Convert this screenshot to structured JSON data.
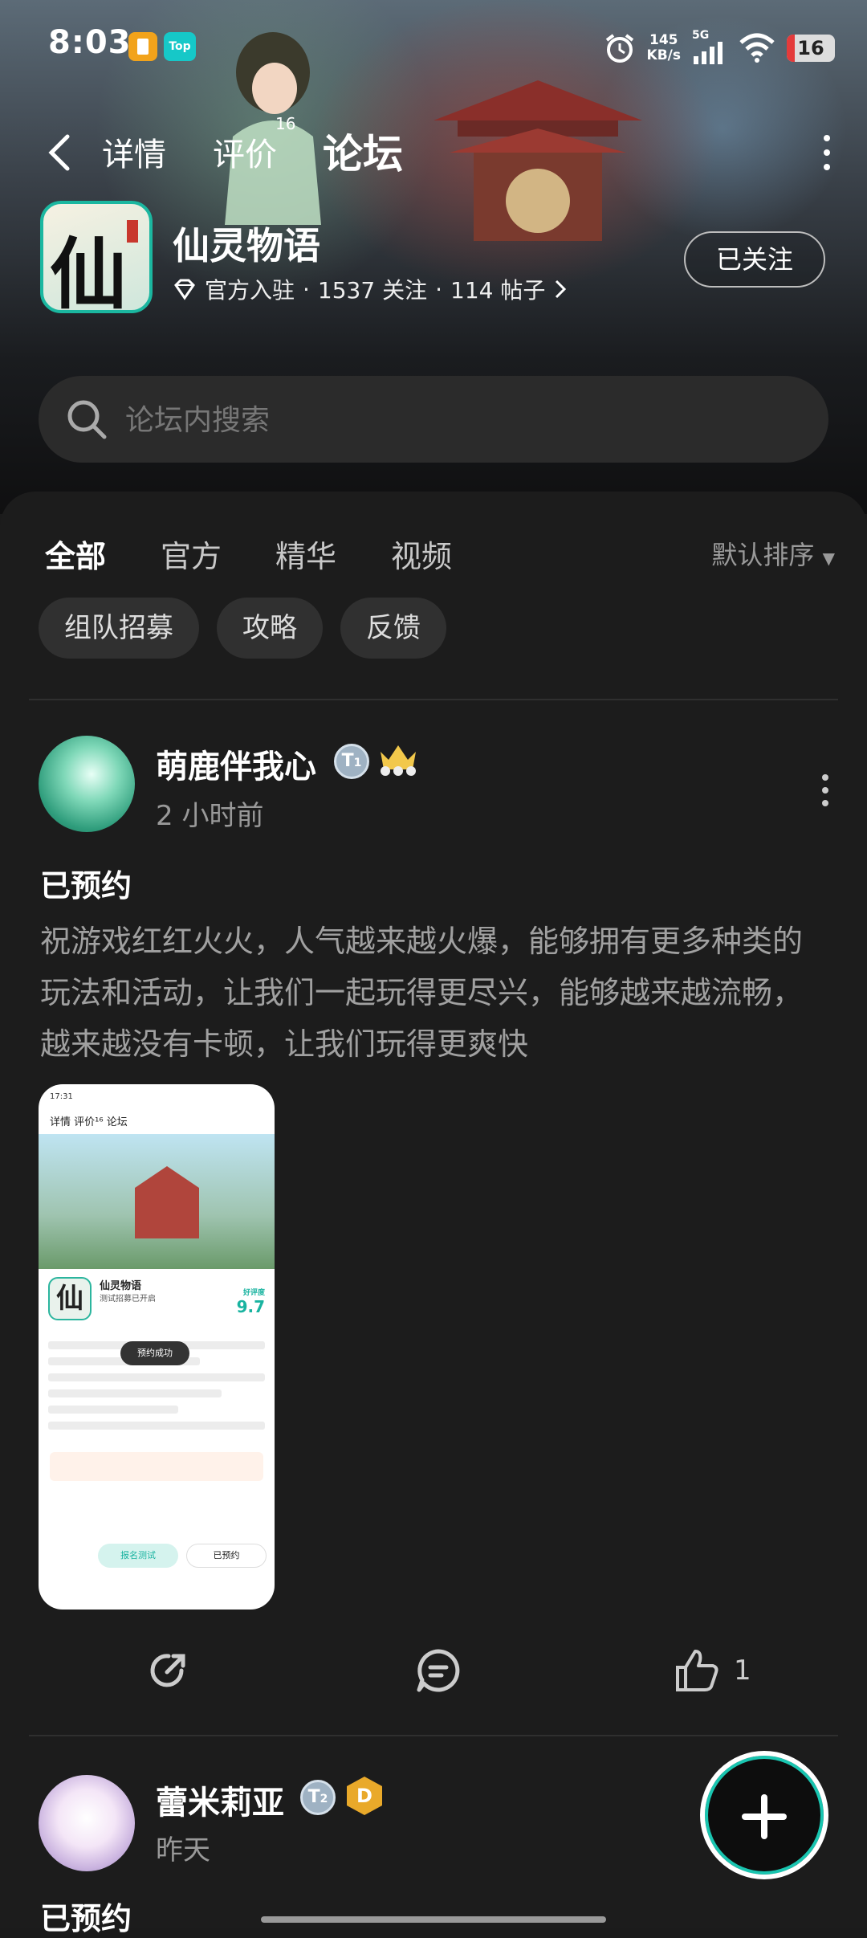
{
  "status_bar": {
    "time": "8:03",
    "notification_badge": "Top",
    "net_speed_value": "145",
    "net_speed_unit": "KB/s",
    "signal_label": "5G",
    "battery": "16"
  },
  "nav": {
    "tabs": [
      {
        "label": "详情"
      },
      {
        "label": "评价",
        "count": "16"
      },
      {
        "label": "论坛",
        "active": true
      }
    ]
  },
  "game": {
    "icon_char": "仙",
    "name": "仙灵物语",
    "meta_official": "官方入驻",
    "meta_followers": "1537 关注",
    "meta_posts": "114 帖子",
    "follow_label": "已关注"
  },
  "search": {
    "placeholder": "论坛内搜索"
  },
  "forum": {
    "tabs": [
      "全部",
      "官方",
      "精华",
      "视频"
    ],
    "active_tab": "全部",
    "sort_label": "默认排序",
    "chips": [
      "组队招募",
      "攻略",
      "反馈"
    ]
  },
  "posts": [
    {
      "user": "萌鹿伴我心",
      "level_badge": "1",
      "time": "2 小时前",
      "title": "已预约",
      "body": "祝游戏红红火火，人气越来越火爆，能够拥有更多种类的玩法和活动，让我们一起玩得更尽兴，能够越来越流畅，越来越没有卡顿，让我们玩得更爽快",
      "screenshot": {
        "time": "17:31",
        "nav": "详情  评价¹⁶  论坛",
        "icon_char": "仙",
        "game_name": "仙灵物语",
        "sub": "测试招募已开启",
        "score_label": "好评度",
        "score": "9.7",
        "toast": "预约成功",
        "btn_signup": "报名测试",
        "btn_reserved": "已预约"
      },
      "likes": "1"
    },
    {
      "user": "蕾米莉亚",
      "level_badge": "2",
      "gold_badge": "D",
      "time": "昨天",
      "title": "已预约"
    }
  ],
  "colors": {
    "accent": "#19c5b0",
    "background": "#1b1b1b"
  }
}
